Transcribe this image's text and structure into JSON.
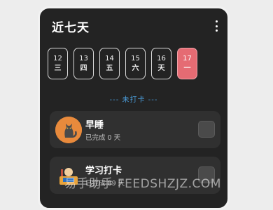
{
  "header": {
    "title": "近七天",
    "more_icon": "more-vertical-icon"
  },
  "days": [
    {
      "num": "12",
      "weekday": "三",
      "active": false
    },
    {
      "num": "13",
      "weekday": "四",
      "active": false
    },
    {
      "num": "14",
      "weekday": "五",
      "active": false
    },
    {
      "num": "15",
      "weekday": "六",
      "active": false
    },
    {
      "num": "16",
      "weekday": "天",
      "active": false
    },
    {
      "num": "17",
      "weekday": "一",
      "active": true
    }
  ],
  "section": {
    "label": "--- 未打卡 ---"
  },
  "items": [
    {
      "name": "早睡",
      "status": "已完成 0 天",
      "icon": "cat-avatar-icon"
    },
    {
      "name": "学习打卡",
      "status": "已完成 89 天",
      "icon": "study-avatar-icon"
    }
  ],
  "watermark": {
    "text": "易手助手 FEEDSHZJZ.COM"
  },
  "colors": {
    "card_bg": "#232323",
    "accent_day": "#e56b73",
    "section_label": "#4a9bd8",
    "item_bg": "#303030"
  }
}
